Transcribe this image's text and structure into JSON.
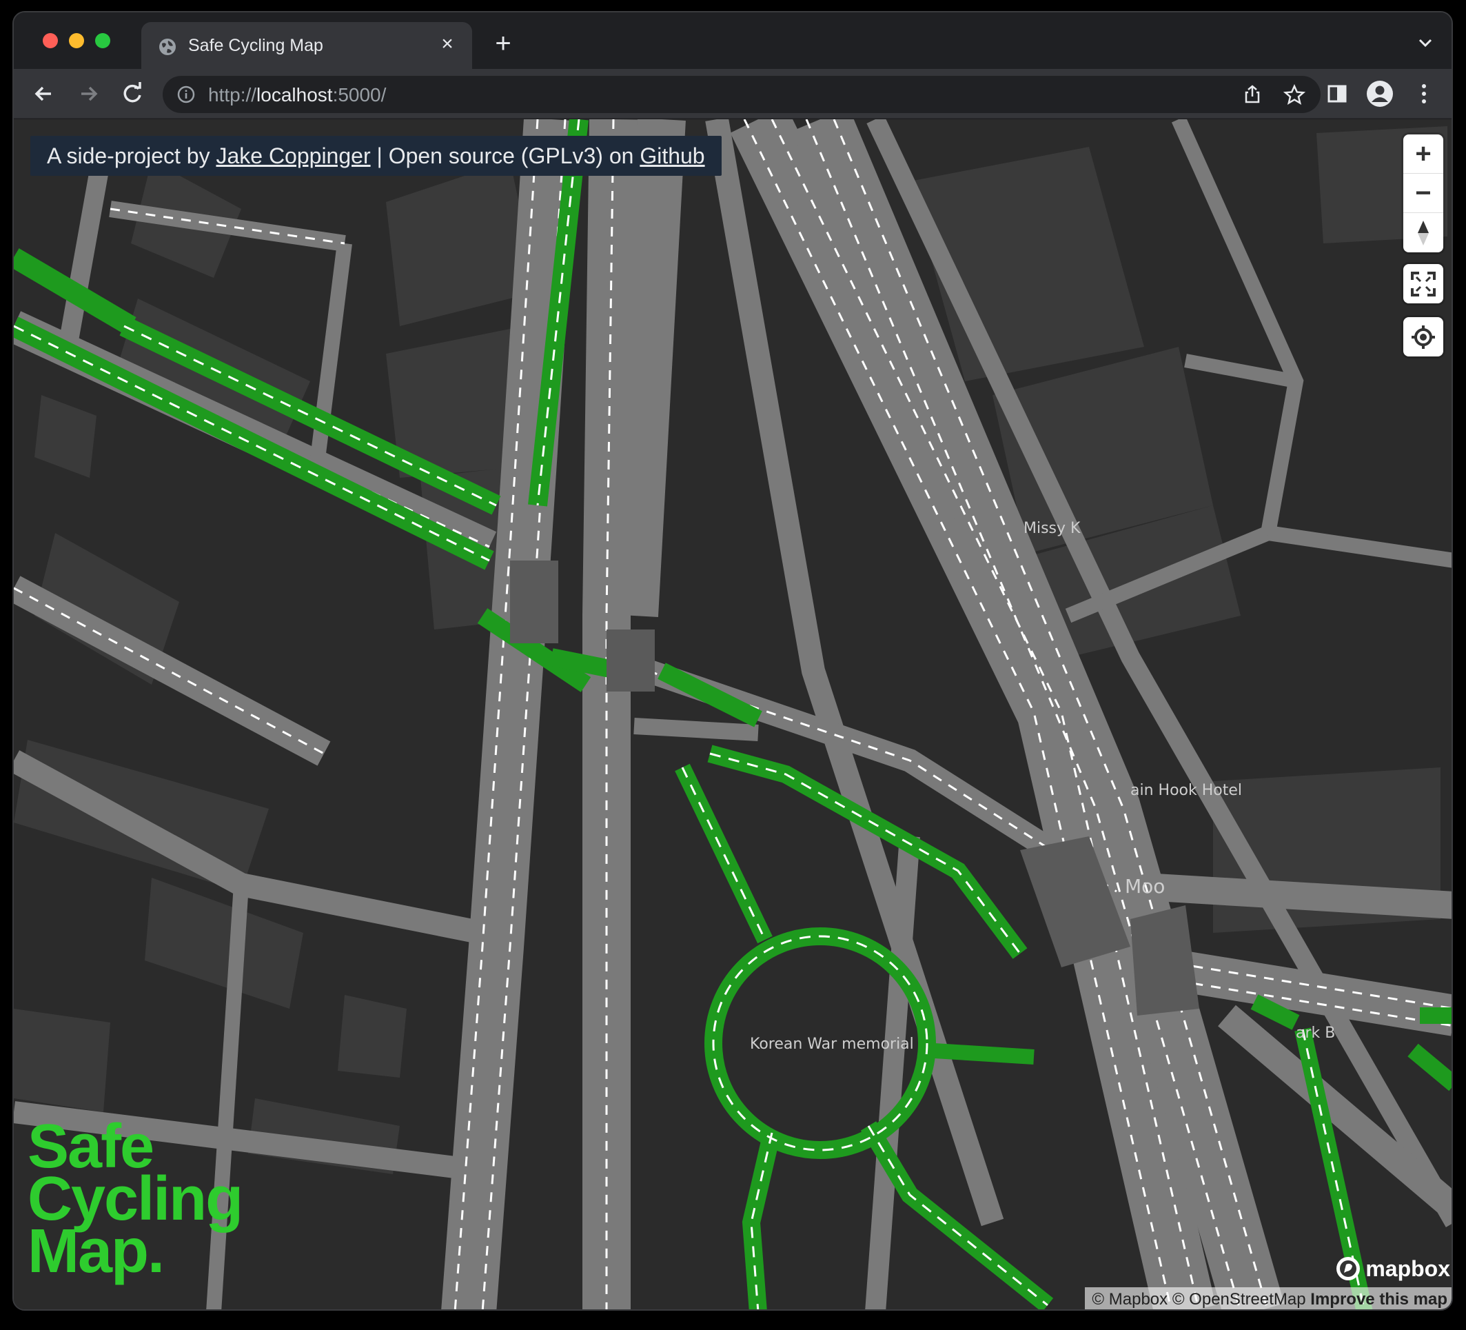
{
  "browser": {
    "tab_title": "Safe Cycling Map",
    "url_scheme": "http://",
    "url_host": "localhost",
    "url_rest": ":5000/"
  },
  "banner": {
    "prefix": "A side-project by ",
    "author": "Jake Coppinger",
    "middle": " | Open source (GPLv3) on ",
    "repo": "Github"
  },
  "map": {
    "labels": {
      "missy_k": "Missy K",
      "hotel": "ain Hook Hotel",
      "memorial": "Korean War memorial",
      "moo": "Moo",
      "park": "ark B"
    },
    "controls": {
      "zoom_in": "+",
      "zoom_out": "−"
    },
    "colors": {
      "cycleway": "#1e9a1e",
      "road": "#7a7a7a",
      "background": "#2b2b2b",
      "building": "#3a3a3a",
      "logo": "#2ecc2e"
    }
  },
  "logo": {
    "line1": "Safe",
    "line2": "Cycling",
    "line3": "Map."
  },
  "attribution": {
    "mapbox": "© Mapbox",
    "osm": "© OpenStreetMap",
    "improve": "Improve this map",
    "brand": "mapbox"
  }
}
